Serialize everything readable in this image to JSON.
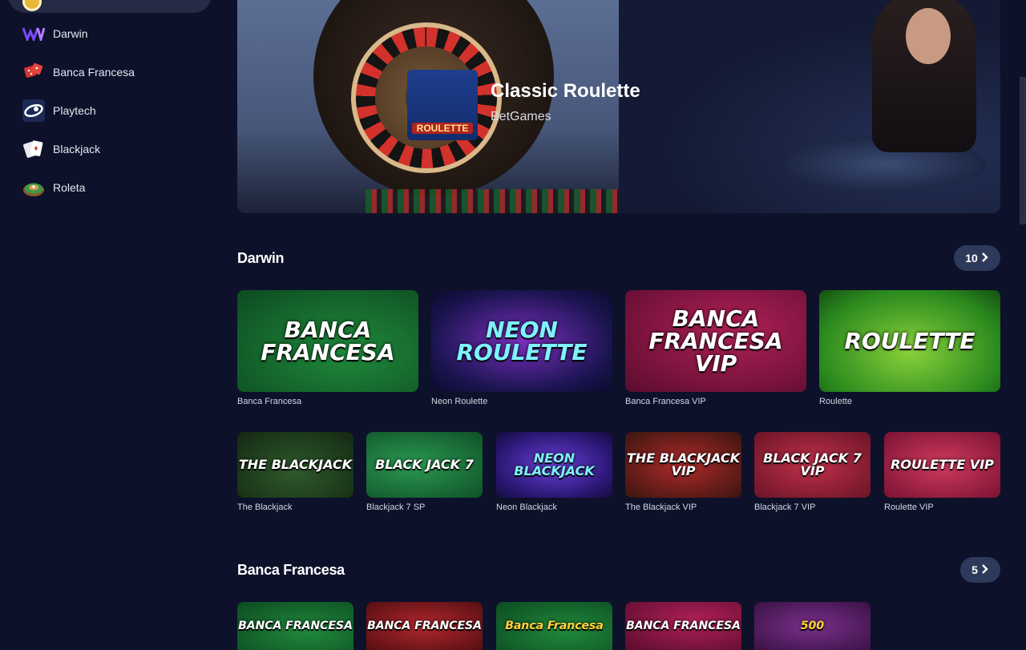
{
  "sidebar": {
    "items": [
      {
        "label": "Darwin",
        "icon": "darwin-logo-icon"
      },
      {
        "label": "Banca Francesa",
        "icon": "dice-icon"
      },
      {
        "label": "Playtech",
        "icon": "playtech-logo-icon"
      },
      {
        "label": "Blackjack",
        "icon": "playing-cards-icon"
      },
      {
        "label": "Roleta",
        "icon": "roulette-wheel-icon"
      }
    ]
  },
  "hero": {
    "title": "Classic Roulette",
    "provider": "BetGames",
    "thumb_text": "ROULETTE"
  },
  "sections": {
    "darwin": {
      "title": "Darwin",
      "count": "10",
      "row1": [
        {
          "name": "Banca Francesa",
          "art": "BANCA FRANCESA"
        },
        {
          "name": "Neon Roulette",
          "art": "NEON ROULETTE"
        },
        {
          "name": "Banca Francesa VIP",
          "art": "BANCA FRANCESA VIP"
        },
        {
          "name": "Roulette",
          "art": "ROULETTE"
        }
      ],
      "row2": [
        {
          "name": "The Blackjack",
          "art": "THE BLACKJACK"
        },
        {
          "name": "Blackjack 7 SP",
          "art": "BLACK JACK 7"
        },
        {
          "name": "Neon Blackjack",
          "art": "NEON BLACKJACK"
        },
        {
          "name": "The Blackjack VIP",
          "art": "THE BLACKJACK VIP"
        },
        {
          "name": "Blackjack 7 VIP",
          "art": "BLACK JACK 7 VIP"
        },
        {
          "name": "Roulette VIP",
          "art": "ROULETTE VIP"
        }
      ]
    },
    "banca": {
      "title": "Banca Francesa",
      "count": "5",
      "row": [
        {
          "art": "BANCA FRANCESA"
        },
        {
          "art": "BANCA FRANCESA"
        },
        {
          "art": "Banca Francesa"
        },
        {
          "art": "BANCA FRANCESA"
        },
        {
          "art": "500"
        }
      ]
    }
  },
  "colors": {
    "background": "#0d1129",
    "pill": "#252a45",
    "count_button": "#2e3a5c"
  }
}
